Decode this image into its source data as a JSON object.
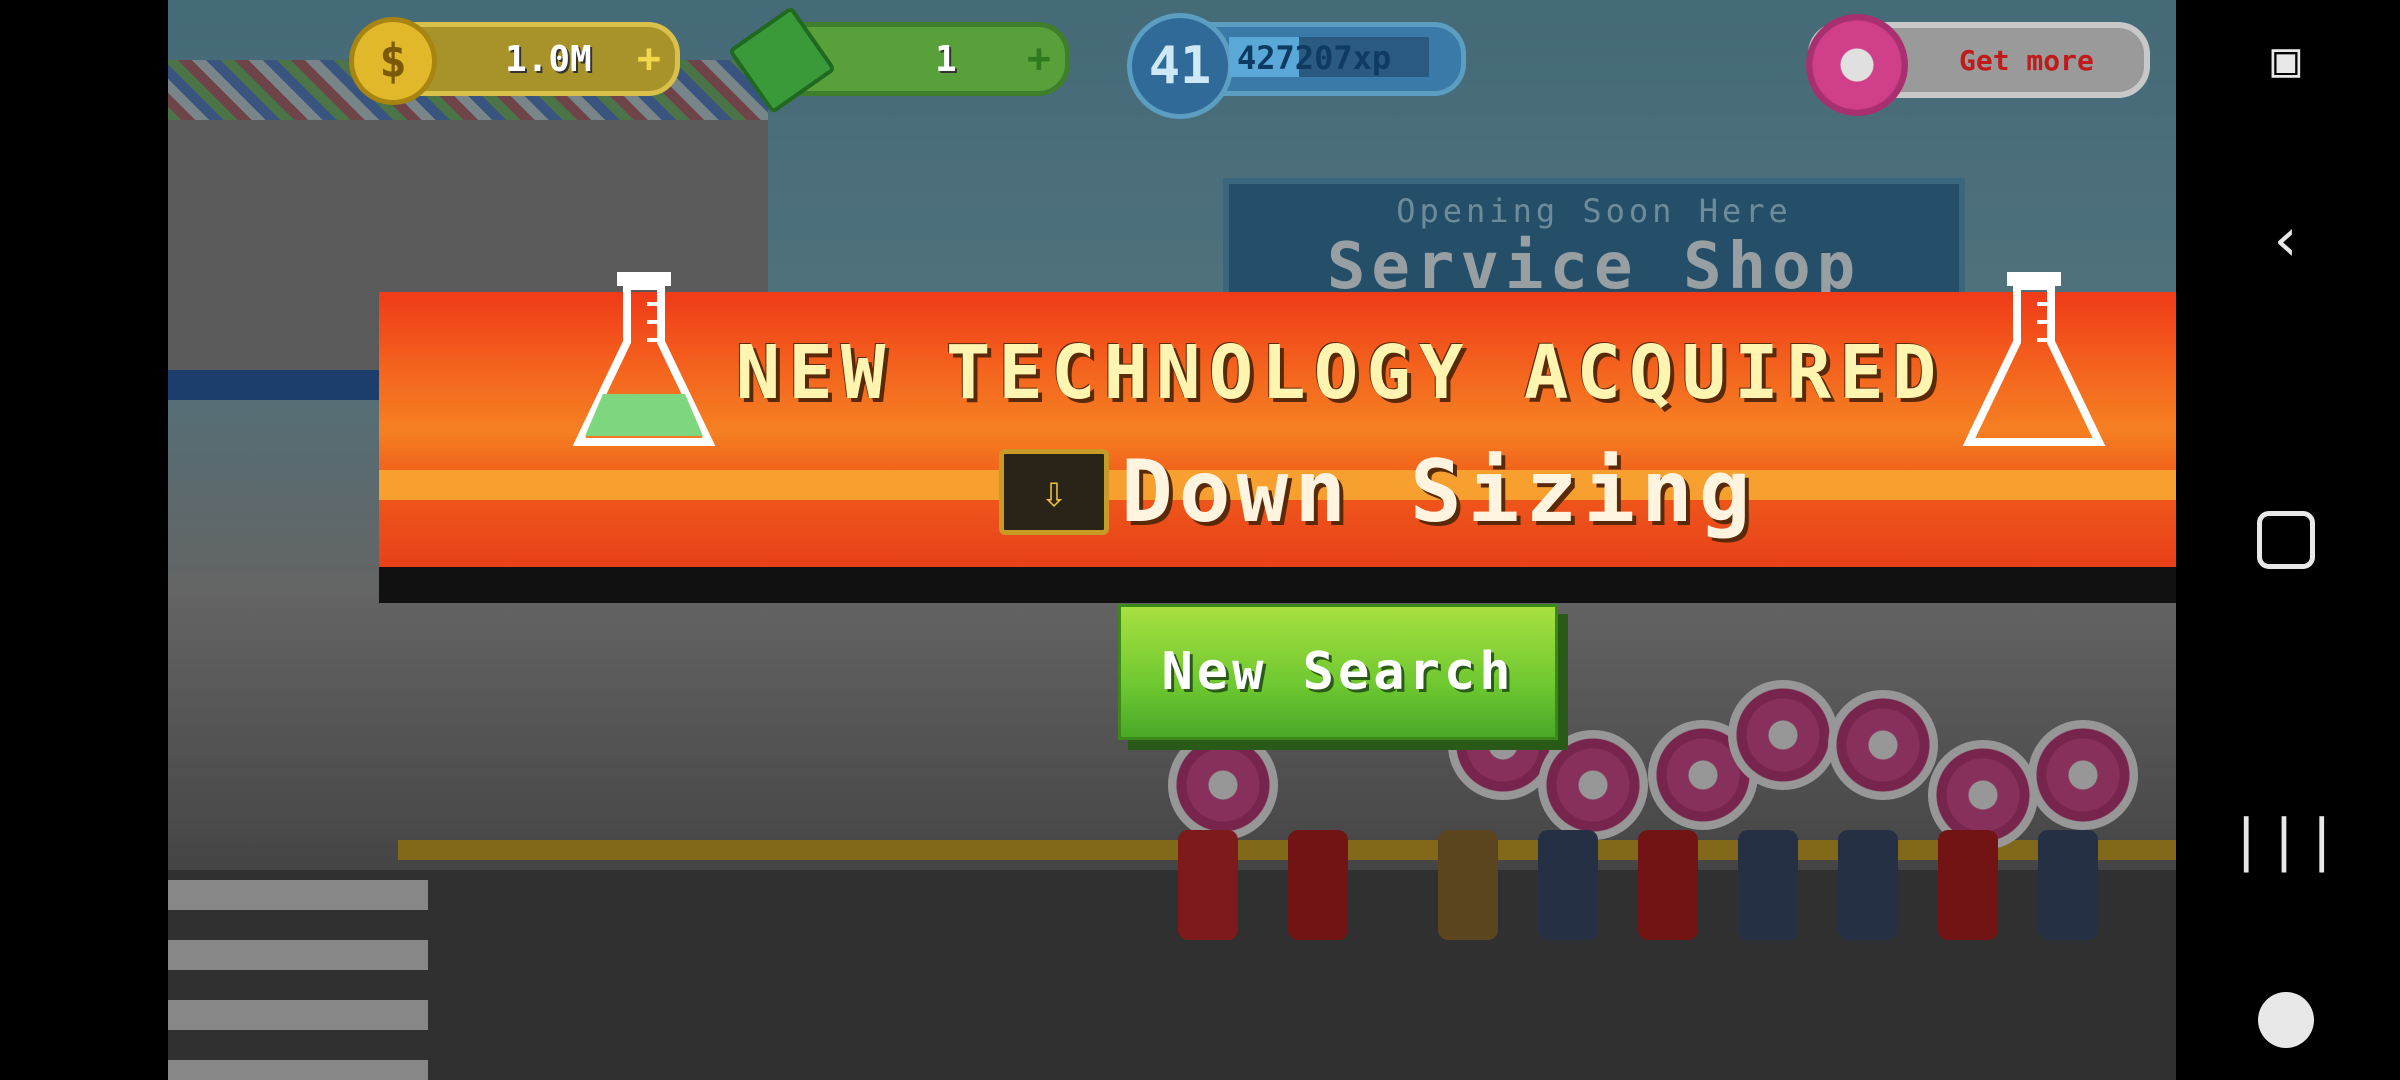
{
  "hud": {
    "coins": "1.0M",
    "cash": "1",
    "level": "41",
    "xp": "427207xp",
    "xp_progress": 0.35,
    "donut_label": "Get more"
  },
  "background": {
    "sign_small": "Opening Soon Here",
    "sign_big": "Service Shop"
  },
  "banner": {
    "title": "NEW TECHNOLOGY ACQUIRED",
    "tech_name": "Down Sizing",
    "tech_icon": "down-sizing-icon"
  },
  "actions": {
    "new_search": "New Search"
  },
  "system_nav": {
    "icons": [
      "screen-capture-icon",
      "back-icon",
      "home-icon",
      "recents-icon",
      "game-launcher-icon"
    ]
  },
  "colors": {
    "banner": "#f4661e",
    "button": "#6ec830",
    "title_text": "#fff4b0"
  }
}
